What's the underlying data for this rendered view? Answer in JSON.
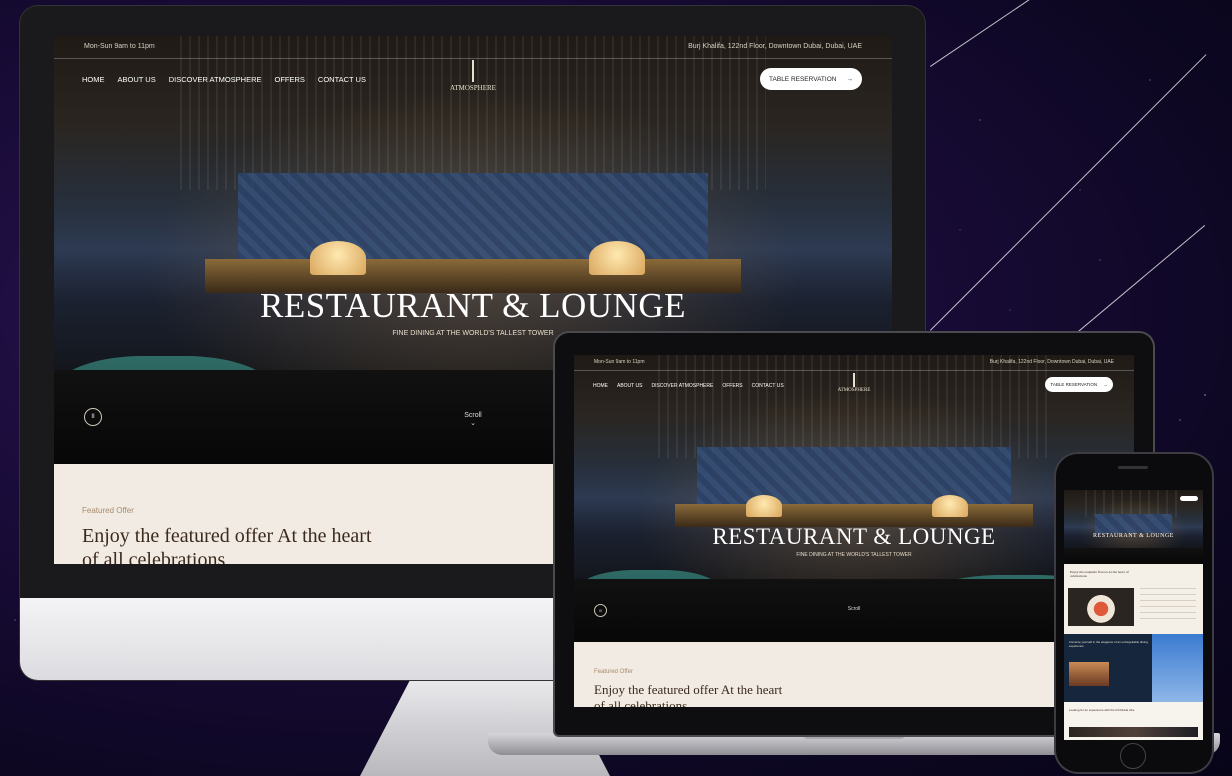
{
  "site": {
    "hours": "Mon-Sun 9am to 11pm",
    "address": "Burj Khalifa, 122nd Floor, Downtown Dubai, Dubai, UAE",
    "nav": [
      "HOME",
      "ABOUT US",
      "DISCOVER ATMOSPHERE",
      "OFFERS",
      "CONTACT US"
    ],
    "logo_text": "ATMOSPHERE",
    "reservation_label": "TABLE RESERVATION",
    "reservation_arrow": "→",
    "hero_title": "RESTAURANT & LOUNGE",
    "hero_subtitle": "FINE DINING AT THE WORLD'S TALLEST TOWER",
    "scroll_label": "Scroll",
    "scroll_arrow": "⌄",
    "pause_icon": "pause-icon",
    "pause_glyph": "II",
    "featured_label": "Featured Offer",
    "featured_heading": "Enjoy the featured offer At the heart of all celebrations"
  },
  "phone": {
    "hero_title": "RESTAURANT & LOUNGE",
    "offer_heading": "Enjoy the exquisite flavors At the heart of celebrations",
    "promo_text": "Immerse yourself in the elegance of an unforgettable dining experience",
    "section_title": "Looking for an experience with the full Dubai vibe"
  }
}
